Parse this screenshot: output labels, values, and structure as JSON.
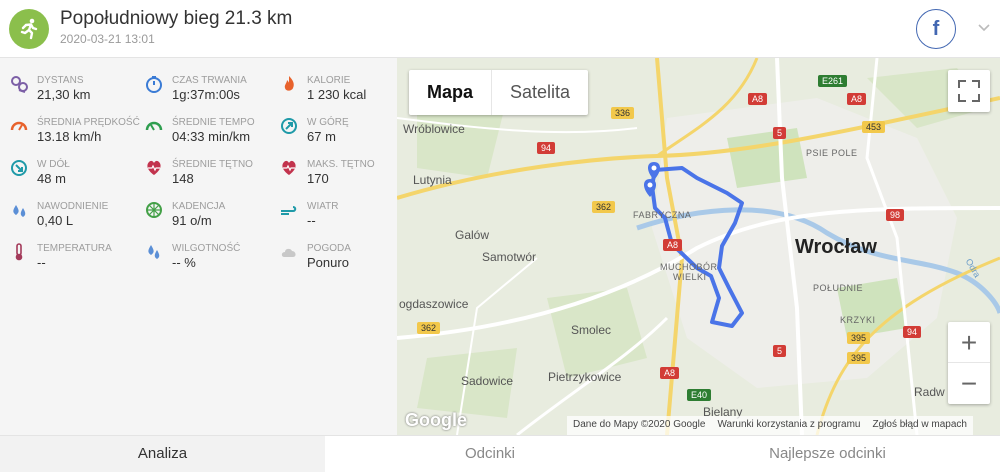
{
  "workout": {
    "title": "Popołudniowy bieg 21.3 km",
    "datetime": "2020-03-21 13:01",
    "icon": "running-icon",
    "accent_color": "#8bbf4c"
  },
  "share": {
    "facebook_letter": "f"
  },
  "stats": [
    {
      "label": "Dystans",
      "value": "21,30 km",
      "icon": "distance-icon",
      "color": "#7c5fa6"
    },
    {
      "label": "Czas trwania",
      "value": "1g:37m:00s",
      "icon": "stopwatch-icon",
      "color": "#3a7bd5"
    },
    {
      "label": "Kalorie",
      "value": "1 230 kcal",
      "icon": "flame-icon",
      "color": "#e8622c"
    },
    {
      "label": "Średnia prędkość",
      "value": "13.18 km/h",
      "icon": "speedometer-icon",
      "color": "#e8622c"
    },
    {
      "label": "Średnie tempo",
      "value": "04:33 min/km",
      "icon": "pace-gauge-icon",
      "color": "#2e9e4f"
    },
    {
      "label": "W górę",
      "value": "67 m",
      "icon": "ascent-icon",
      "color": "#1f9aa8"
    },
    {
      "label": "W dół",
      "value": "48 m",
      "icon": "descent-icon",
      "color": "#1f9aa8"
    },
    {
      "label": "Średnie tętno",
      "value": "148",
      "icon": "heart-rate-icon",
      "color": "#c2334d"
    },
    {
      "label": "Maks. tętno",
      "value": "170",
      "icon": "heart-max-icon",
      "color": "#c2334d"
    },
    {
      "label": "Nawodnienie",
      "value": "0,40 L",
      "icon": "water-drops-icon",
      "color": "#5b8fd6"
    },
    {
      "label": "Kadencja",
      "value": "91 o/m",
      "icon": "cadence-icon",
      "color": "#43a047"
    },
    {
      "label": "Wiatr",
      "value": "--",
      "icon": "wind-icon",
      "color": "#1f9aa8"
    },
    {
      "label": "Temperatura",
      "value": "--",
      "icon": "thermometer-icon",
      "color": "#a33a5a"
    },
    {
      "label": "Wilgotność",
      "value": "-- %",
      "icon": "humidity-icon",
      "color": "#5b8fd6"
    },
    {
      "label": "Pogoda",
      "value": "Ponuro",
      "icon": "cloud-icon",
      "color": "#c8c8c8"
    }
  ],
  "map": {
    "type_buttons": {
      "map": "Mapa",
      "satellite": "Satelita"
    },
    "zoom": {
      "in": "+",
      "out": "−"
    },
    "route_color": "#4a74e8",
    "labels": {
      "wroclaw": "Wrocław",
      "wroblowice": "Wróblowice",
      "lutynia": "Lutynia",
      "galow": "Galów",
      "samotwor": "Samotwór",
      "rogdaszowice": "ogdaszowice",
      "smolec": "Smolec",
      "sadowice": "Sadowice",
      "pietrzykowice": "Pietrzykowice",
      "bielany": "Bielany",
      "radw": "Radw",
      "psie_pole": "PSIE POLE",
      "fabryczna": "FABRYCZNA",
      "muchobor": "MUCHOBÓR",
      "wielki": "WIELKI",
      "poludnie": "POŁUDNIE",
      "krzyki": "KRZYKI",
      "odra": "Odra"
    },
    "road_badges": {
      "r336": "336",
      "r94a": "94",
      "r362a": "362",
      "a8a": "A8",
      "a8b": "A8",
      "e261": "E261",
      "r453": "453",
      "r5a": "5",
      "a8c": "A8",
      "r98": "98",
      "r362b": "362",
      "r5b": "5",
      "r395a": "395",
      "r395b": "395",
      "r94b": "94",
      "a8d": "A8",
      "e40": "E40"
    },
    "google": "Google",
    "attribution": {
      "data": "Dane do Mapy ©2020 Google",
      "terms": "Warunki korzystania z programu",
      "report": "Zgłoś błąd w mapach"
    }
  },
  "tabs": [
    {
      "label": "Analiza",
      "active": true
    },
    {
      "label": "Odcinki",
      "active": false
    },
    {
      "label": "Najlepsze odcinki",
      "active": false
    }
  ]
}
